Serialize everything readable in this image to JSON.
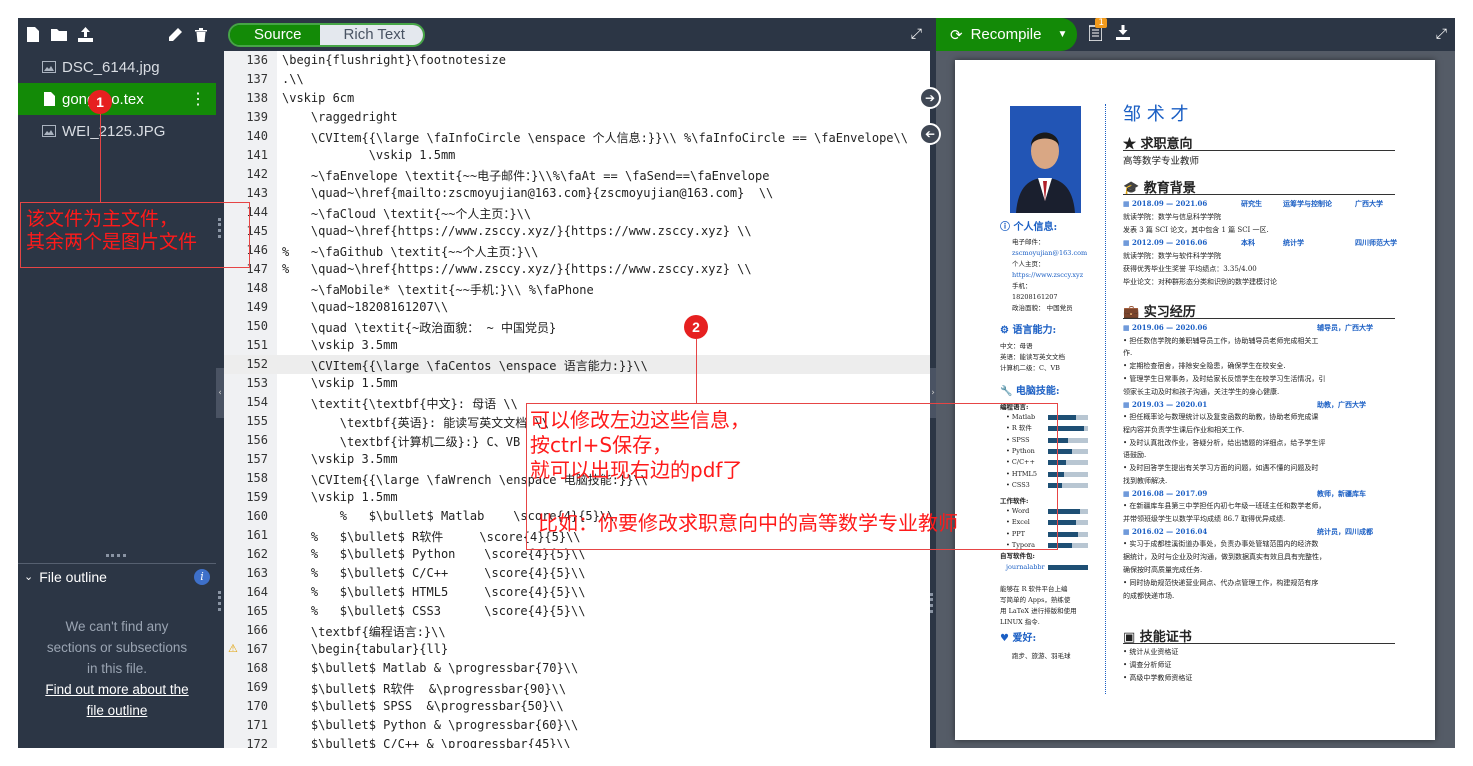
{
  "left_panel": {
    "toolbar_icons": [
      "new-file-icon",
      "new-folder-icon",
      "upload-icon",
      "pencil-icon",
      "trash-icon"
    ],
    "files": [
      {
        "name": "DSC_6144.jpg",
        "icon": "image-icon"
      },
      {
        "name": "gongzuo.tex",
        "icon": "doc-icon",
        "selected": true
      },
      {
        "name": "WEI_2125.JPG",
        "icon": "image-icon"
      }
    ],
    "outline_title": "File outline",
    "outline_empty": [
      "We can't find any",
      "sections or subsections",
      "in this file."
    ],
    "outline_link": [
      "Find out more about the",
      "file outline"
    ]
  },
  "editor": {
    "tabs": [
      "Source",
      "Rich Text"
    ],
    "active_tab": "Source",
    "lines": [
      {
        "n": "136",
        "code": "\\begin{flushright}\\footnotesize"
      },
      {
        "n": "137",
        "code": ".\\\\"
      },
      {
        "n": "138",
        "code": "\\vskip 6cm"
      },
      {
        "n": "139",
        "code": "    \\raggedright"
      },
      {
        "n": "140",
        "code": "    \\CVItem{{\\large \\faInfoCircle \\enspace 个人信息:}}\\\\ %\\faInfoCircle == \\faEnvelope\\\\"
      },
      {
        "n": "141",
        "code": "            \\vskip 1.5mm"
      },
      {
        "n": "142",
        "code": "    ~\\faEnvelope \\textit{~~电子邮件：}\\\\%\\faAt == \\faSend==\\faEnvelope"
      },
      {
        "n": "143",
        "code": "    \\quad~\\href{mailto:zscmoyujian@163.com}{zscmoyujian@163.com}  \\\\"
      },
      {
        "n": "144",
        "code": "    ~\\faCloud \\textit{~~个人主页：}\\\\"
      },
      {
        "n": "145",
        "code": "    \\quad~\\href{https://www.zsccy.xyz/}{https://www.zsccy.xyz} \\\\"
      },
      {
        "n": "146",
        "code": "%   ~\\faGithub \\textit{~~个人主页：}\\\\"
      },
      {
        "n": "147",
        "code": "%   \\quad~\\href{https://www.zsccy.xyz/}{https://www.zsccy.xyz} \\\\"
      },
      {
        "n": "148",
        "code": "    ~\\faMobile* \\textit{~~手机：}\\\\ %\\faPhone"
      },
      {
        "n": "149",
        "code": "    \\quad~18208161207\\\\"
      },
      {
        "n": "150",
        "code": "    \\quad \\textit{~政治面貌： ~ 中国党员}"
      },
      {
        "n": "151",
        "code": "    \\vskip 3.5mm"
      },
      {
        "n": "152",
        "code": "    \\CVItem{{\\large \\faCentos \\enspace 语言能力:}}\\\\"
      },
      {
        "n": "153",
        "code": "    \\vskip 1.5mm"
      },
      {
        "n": "154",
        "code": "    \\textit{\\textbf{中文}: 母语 \\\\"
      },
      {
        "n": "155",
        "code": "        \\textbf{英语}: 能读写英文文档 \\\\"
      },
      {
        "n": "156",
        "code": "        \\textbf{计算机二级}:} C、VB"
      },
      {
        "n": "157",
        "code": "    \\vskip 3.5mm"
      },
      {
        "n": "158",
        "code": "    \\CVItem{{\\large \\faWrench \\enspace 电脑技能:}}\\\\"
      },
      {
        "n": "159",
        "code": "    \\vskip 1.5mm"
      },
      {
        "n": "160",
        "code": "        %   $\\bullet$ Matlab    \\score{4}{5}\\\\"
      },
      {
        "n": "161",
        "code": "    %   $\\bullet$ R软件     \\score{4}{5}\\\\"
      },
      {
        "n": "162",
        "code": "    %   $\\bullet$ Python    \\score{4}{5}\\\\"
      },
      {
        "n": "163",
        "code": "    %   $\\bullet$ C/C++     \\score{4}{5}\\\\"
      },
      {
        "n": "164",
        "code": "    %   $\\bullet$ HTML5     \\score{4}{5}\\\\"
      },
      {
        "n": "165",
        "code": "    %   $\\bullet$ CSS3      \\score{4}{5}\\\\"
      },
      {
        "n": "166",
        "code": "    \\textbf{编程语言:}\\\\"
      },
      {
        "n": "167",
        "code": "    \\begin{tabular}{ll}"
      },
      {
        "n": "168",
        "code": "    $\\bullet$ Matlab & \\progressbar{70}\\\\"
      },
      {
        "n": "169",
        "code": "    $\\bullet$ R软件  &\\progressbar{90}\\\\"
      },
      {
        "n": "170",
        "code": "    $\\bullet$ SPSS  &\\progressbar{50}\\\\"
      },
      {
        "n": "171",
        "code": "    $\\bullet$ Python & \\progressbar{60}\\\\"
      },
      {
        "n": "172",
        "code": "    $\\bullet$ C/C++ & \\progressbar{45}\\\\"
      }
    ]
  },
  "annotations": {
    "badge1": "1",
    "badge2": "2",
    "note1": "该文件为主文件，\n其余两个是图片文件",
    "note2a": "可以修改左边这些信息，\n按ctrl+S保存，\n就可以出现右边的pdf了",
    "note2b": "比如：你要修改求职意向中的高等数学专业教师"
  },
  "pdf_toolbar": {
    "recompile": "Recompile",
    "log_count": "1"
  },
  "pdf": {
    "name": "邹 术 才",
    "objective_title": "求职意向",
    "objective": "高等数学专业教师",
    "edu_title": "教育背景",
    "edu": [
      {
        "date": "2018.09 — 2021.06",
        "degree": "研究生",
        "major": "运筹学与控制论",
        "school": "广西大学",
        "lines": [
          "就读学院：数学与信息科学学院",
          "发表 3 篇 SCI 论文，其中包含 1 篇 SCI 一区."
        ]
      },
      {
        "date": "2012.09 — 2016.06",
        "degree": "本科",
        "major": "统计学",
        "school": "四川师范大学",
        "lines": [
          "就读学院：数学与软件科学学院",
          "获得优秀毕业生奖誉       平均绩点：3.35/4.00",
          "毕业论文：对种群形态分类和识别的数学建模讨论"
        ]
      }
    ],
    "work_title": "实习经历",
    "work": [
      {
        "date": "2019.06 — 2020.06",
        "role": "辅导员，广西大学",
        "lines": [
          "• 担任数信学院的兼职辅导员工作，协助辅导员老师完成相关工",
          "作.",
          "• 定期检查宿舍，排除安全隐患，确保学生在校安全.",
          "• 管理学生日常事务，及时给家长反馈学生在校学习生活情况，引",
          "领家长主动及时和孩子沟通，关注学生的身心健康."
        ]
      },
      {
        "date": "2019.03 — 2020.01",
        "role": "助教，广西大学",
        "lines": [
          "• 担任概率论与数理统计以及复变函数的助教，协助老师完成课",
          "程内容并负责学生课后作业和相关工作.",
          "• 及时认真批改作业，答疑分析，给出错题的详细点，给予学生评",
          "语鼓励.",
          "• 及时回答学生提出有关学习方面的问题，如遇不懂的问题及时",
          "找到教师解决."
        ]
      },
      {
        "date": "2016.08 — 2017.09",
        "role": "教师，新疆库车",
        "lines": [
          "• 在新疆库车县第三中学担任内初七年级一班班主任和数学老师，",
          "并带领班级学生以数学平均成绩 86.7 取得优异成绩."
        ]
      },
      {
        "date": "2016.02 — 2016.04",
        "role": "统计员，四川成都",
        "lines": [
          "• 实习于成都桂溪街道办事处，负责办事处管辖范围内的经济数",
          "据统计，及时与企业及时沟通，做到数据真实有效且具有完整性，",
          "确保按时高质量完成任务.",
          "• 同时协助规范快递营业网点、代办点管理工作，构建规范有序",
          "的成都快递市场."
        ]
      }
    ],
    "cert_title": "技能证书",
    "certs": [
      "• 统计从业资格证",
      "• 调查分析师证",
      "• 高级中学教师资格证"
    ],
    "info_title": "个人信息:",
    "info_lines": [
      "电子邮件：",
      "zscmoyujian@163.com",
      "个人主页：",
      "https://www.zsccy.xyz",
      "手机：",
      "18208161207",
      "政治面貌：   中国党员"
    ],
    "lang_title": "语言能力:",
    "lang_lines": [
      "中文：母语",
      "英语：能读写英文文档",
      "计算机二级：C、VB"
    ],
    "skill_title": "电脑技能:",
    "prog_label": "编程语言:",
    "prog": [
      {
        "name": "• Matlab",
        "level": 0.7
      },
      {
        "name": "• R 软件",
        "level": 0.9
      },
      {
        "name": "• SPSS",
        "level": 0.5
      },
      {
        "name": "• Python",
        "level": 0.6
      },
      {
        "name": "• C/C++",
        "level": 0.45
      },
      {
        "name": "• HTML5",
        "level": 0.4
      },
      {
        "name": "• CSS3",
        "level": 0.35
      }
    ],
    "tool_label": "工作软件:",
    "tools": [
      {
        "name": "• Word",
        "level": 0.8
      },
      {
        "name": "• Excel",
        "level": 0.7
      },
      {
        "name": "• PPT",
        "level": 0.75
      },
      {
        "name": "• Typora",
        "level": 0.6
      }
    ],
    "self_label": "自写软件包:",
    "self_pkg": {
      "name": "journalabbr",
      "level": 1.0
    },
    "note_lines": [
      "能够在 R 软件平台上编",
      "写简单的 Apps，熟练使",
      "用 LaTeX 进行排版和使用",
      "LINUX 指令."
    ],
    "hobby_title": "爱好:",
    "hobby": "跑步、旅游、羽毛球"
  }
}
